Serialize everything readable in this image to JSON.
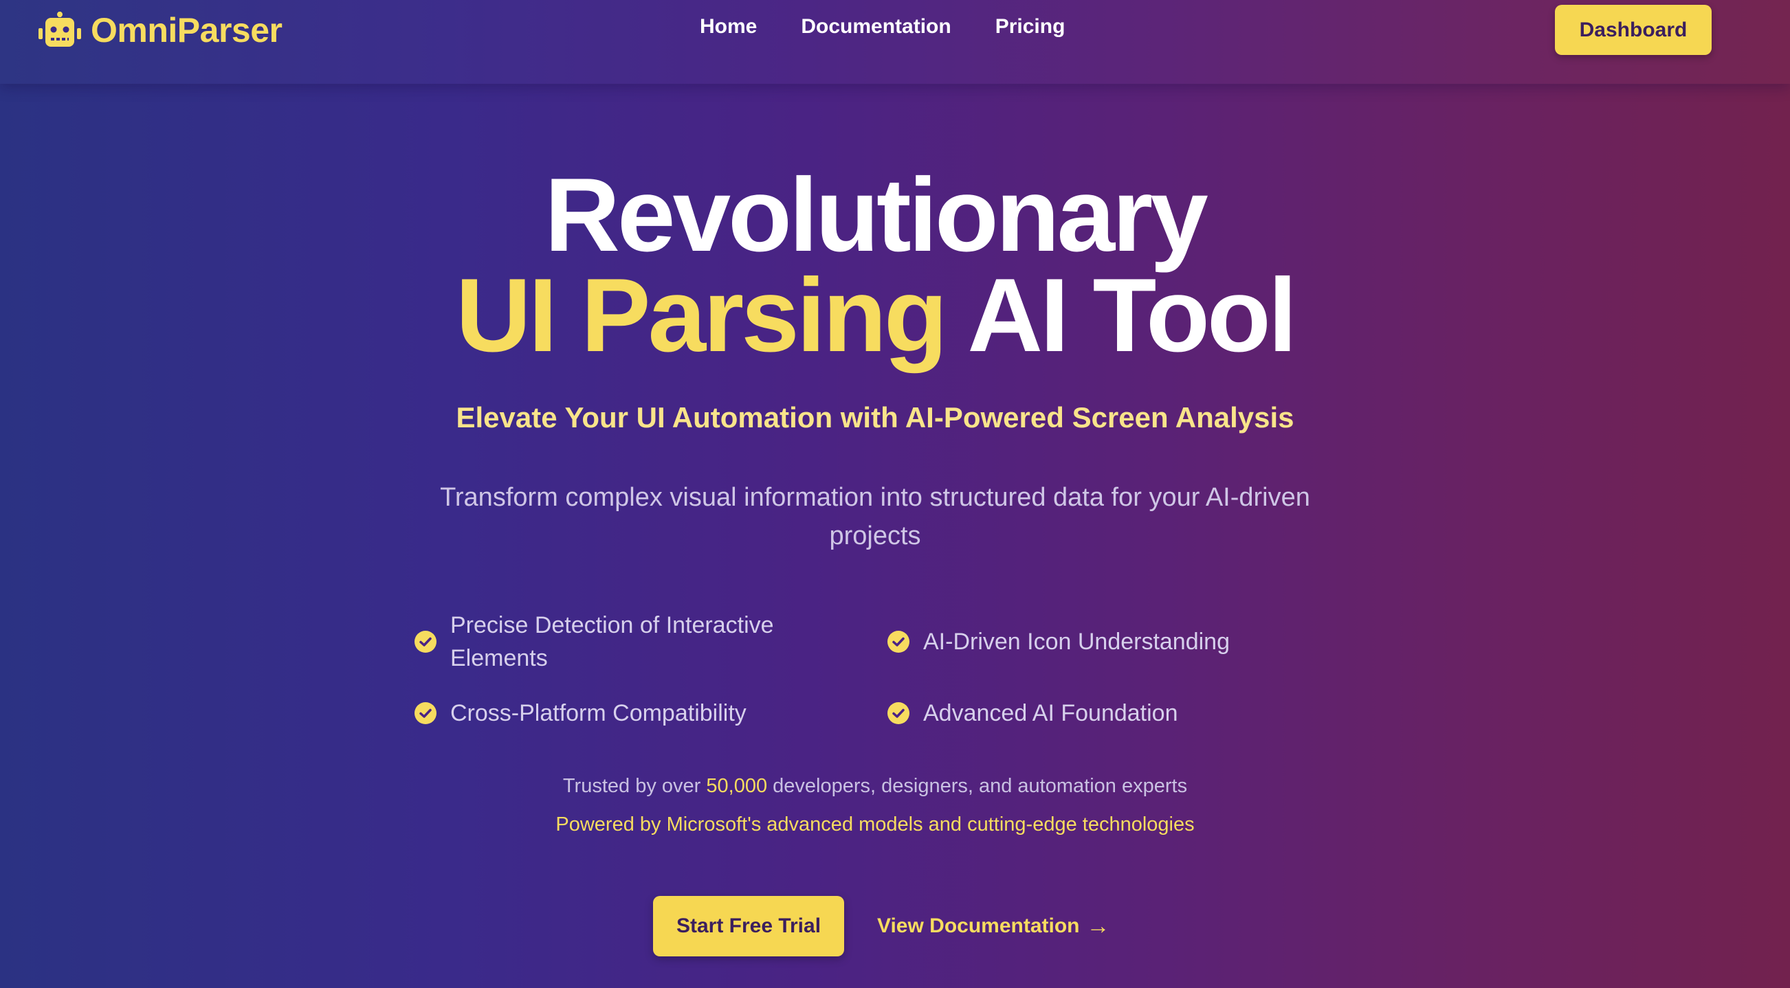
{
  "header": {
    "logo_text": "OmniParser",
    "logo_icon": "robot-icon",
    "nav": [
      {
        "label": "Home"
      },
      {
        "label": "Documentation"
      },
      {
        "label": "Pricing"
      }
    ],
    "dashboard_label": "Dashboard"
  },
  "hero": {
    "title_line1": "Revolutionary",
    "title_accent": "UI Parsing",
    "title_rest": "AI Tool",
    "subtitle": "Elevate Your UI Automation with AI-Powered Screen Analysis",
    "description": "Transform complex visual information into structured data for your AI-driven projects",
    "features": [
      {
        "label": "Precise Detection of Interactive Elements",
        "icon": "check-circle-icon"
      },
      {
        "label": "AI-Driven Icon Understanding",
        "icon": "check-circle-icon"
      },
      {
        "label": "Cross-Platform Compatibility",
        "icon": "check-circle-icon"
      },
      {
        "label": "Advanced AI Foundation",
        "icon": "check-circle-icon"
      }
    ],
    "trusted_prefix": "Trusted by over",
    "trusted_number": "50,000",
    "trusted_suffix": "developers, designers, and automation experts",
    "powered": "Powered by Microsoft's advanced models and cutting-edge technologies",
    "cta_primary": "Start Free Trial",
    "cta_secondary": "View Documentation",
    "cta_secondary_arrow": "→"
  },
  "colors": {
    "accent": "#f7dc5f",
    "button_bg": "#f6d752",
    "button_text": "#3b1f5e",
    "gradient_start": "#2b3283",
    "gradient_mid": "#4a2384",
    "gradient_end": "#72224e"
  }
}
